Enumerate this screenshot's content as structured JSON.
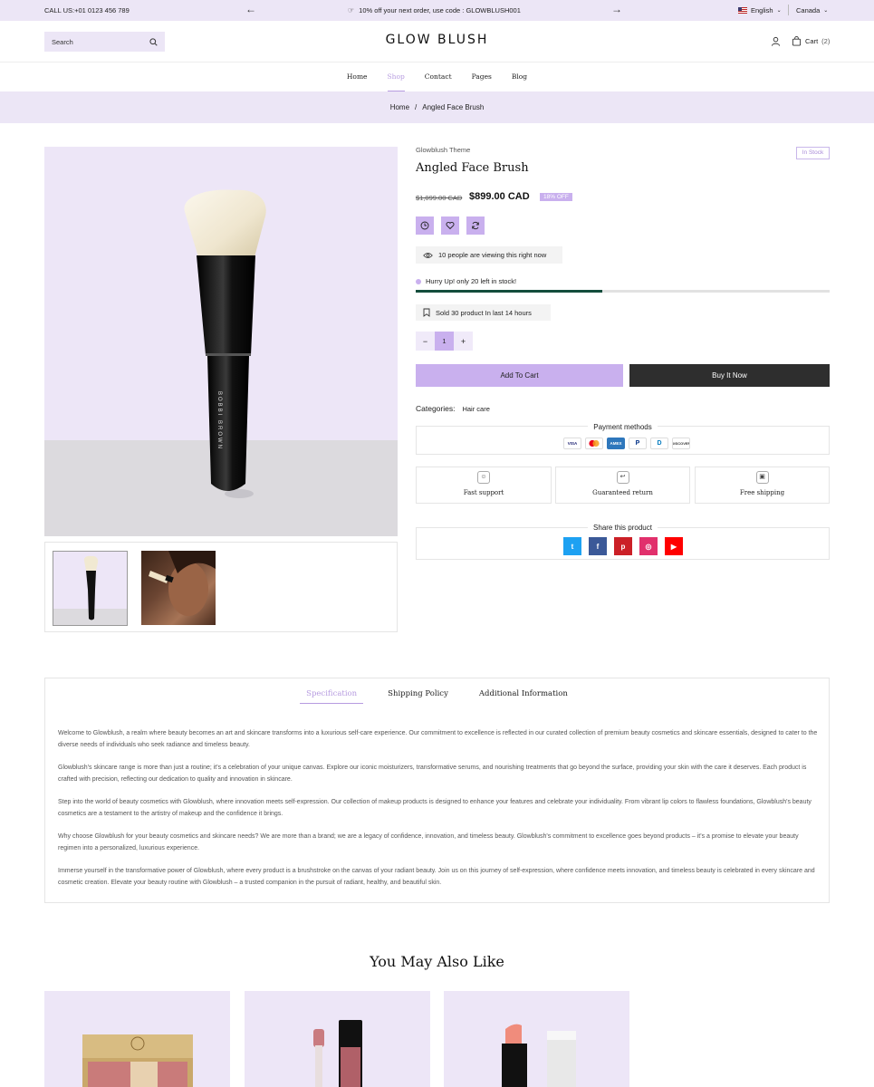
{
  "topbar": {
    "call": "CALL US:+01 0123 456 789",
    "promo": "10% off your next order, use code : GLOWBLUSH001",
    "language": "English",
    "country": "Canada"
  },
  "header": {
    "search_placeholder": "Search",
    "logo": "GLOW BLUSH",
    "cart_label": "Cart",
    "cart_count": "(2)"
  },
  "nav": {
    "items": [
      "Home",
      "Shop",
      "Contact",
      "Pages",
      "Blog"
    ],
    "active": "Shop"
  },
  "breadcrumb": {
    "home": "Home",
    "sep": "/",
    "current": "Angled Face Brush"
  },
  "product": {
    "vendor": "Glowblush Theme",
    "stock": "In Stock",
    "title": "Angled Face Brush",
    "old_price": "$1,099.00 CAD",
    "price": "$899.00 CAD",
    "discount": "18% OFF",
    "viewing": "10 people are viewing this right now",
    "hurry": "Hurry Up! only 20 left in stock!",
    "stock_progress_pct": 45,
    "sold": "Sold 30 product In last 14 hours",
    "quantity": "1",
    "add_to_cart": "Add To Cart",
    "buy_now": "Buy It Now",
    "categories_label": "Categories:",
    "categories_value": "Hair care",
    "brush_text": "BOBBI BROWN"
  },
  "payment": {
    "label": "Payment methods",
    "cards": [
      "VISA",
      "MC",
      "AMEX",
      "P",
      "D",
      "DISCOVER"
    ]
  },
  "features": [
    "Fast support",
    "Guaranteed return",
    "Free shipping"
  ],
  "share": {
    "label": "Share this product",
    "networks": [
      {
        "name": "twitter",
        "glyph": "t",
        "color": "#1da1f2"
      },
      {
        "name": "facebook",
        "glyph": "f",
        "color": "#3b5998"
      },
      {
        "name": "pinterest",
        "glyph": "p",
        "color": "#cb2027"
      },
      {
        "name": "instagram",
        "glyph": "◎",
        "color": "#e1306c"
      },
      {
        "name": "youtube",
        "glyph": "▶",
        "color": "#ff0000"
      }
    ]
  },
  "tabs": {
    "items": [
      "Specification",
      "Shipping Policy",
      "Additional Information"
    ],
    "active": "Specification",
    "paragraphs": [
      "Welcome to Glowblush, a realm where beauty becomes an art and skincare transforms into a luxurious self-care experience. Our commitment to excellence is reflected in our curated collection of premium beauty cosmetics and skincare essentials, designed to cater to the diverse needs of individuals who seek radiance and timeless beauty.",
      "Glowblush's skincare range is more than just a routine; it's a celebration of your unique canvas. Explore our iconic moisturizers, transformative serums, and nourishing treatments that go beyond the surface, providing your skin with the care it deserves. Each product is crafted with precision, reflecting our dedication to quality and innovation in skincare.",
      "Step into the world of beauty cosmetics with Glowblush, where innovation meets self-expression. Our collection of makeup products is designed to enhance your features and celebrate your individuality. From vibrant lip colors to flawless foundations, Glowblush's beauty cosmetics are a testament to the artistry of makeup and the confidence it brings.",
      "Why choose Glowblush for your beauty cosmetics and skincare needs? We are more than a brand; we are a legacy of confidence, innovation, and timeless beauty. Glowblush's commitment to excellence goes beyond products – it's a promise to elevate your beauty regimen into a personalized, luxurious experience.",
      "Immerse yourself in the transformative power of Glowblush, where every product is a brushstroke on the canvas of your radiant beauty. Join us on this journey of self-expression, where confidence meets innovation, and timeless beauty is celebrated in every skincare and cosmetic creation. Elevate your beauty routine with Glowblush – a trusted companion in the pursuit of radiant, healthy, and beautiful skin."
    ]
  },
  "related": {
    "title": "You May Also Like"
  }
}
